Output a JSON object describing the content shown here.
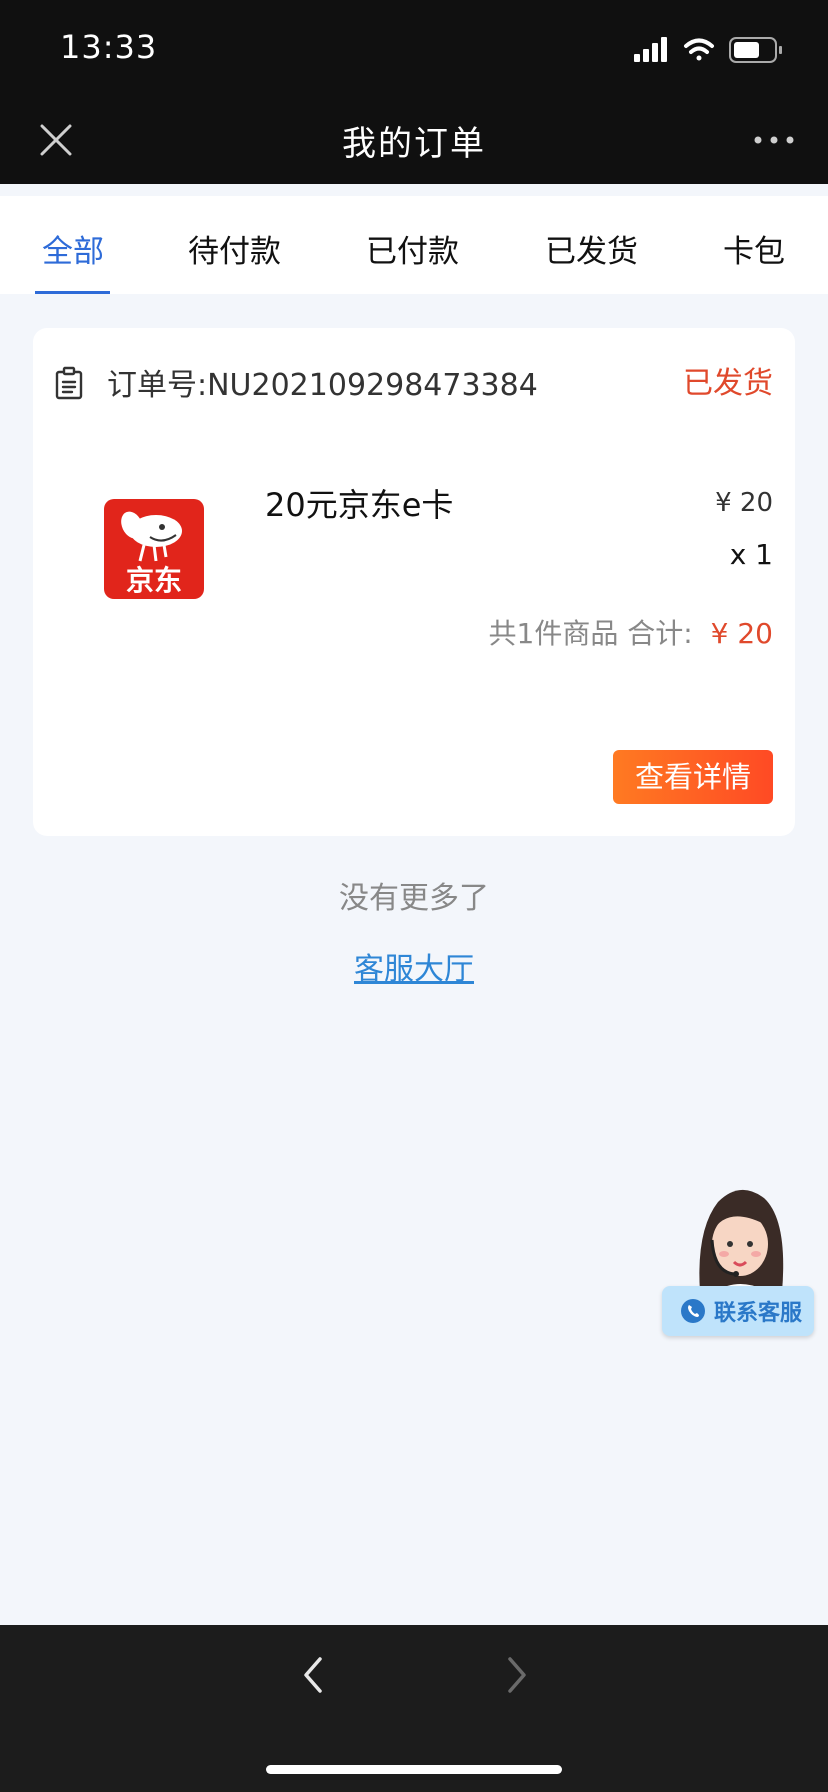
{
  "status_bar": {
    "time": "13:33"
  },
  "header": {
    "title": "我的订单"
  },
  "tabs": [
    {
      "label": "全部",
      "active": true
    },
    {
      "label": "待付款",
      "active": false
    },
    {
      "label": "已付款",
      "active": false
    },
    {
      "label": "已发货",
      "active": false
    },
    {
      "label": "卡包",
      "active": false
    }
  ],
  "order": {
    "order_number": "订单号:NU202109298473384",
    "status": "已发货",
    "product": {
      "name": "20元京东e卡",
      "logo_text": "京东",
      "price": "¥ 20",
      "quantity": "x 1"
    },
    "summary_label": "共1件商品 合计:",
    "total": "¥ 20",
    "detail_button": "查看详情"
  },
  "footer": {
    "no_more": "没有更多了",
    "service_link": "客服大厅"
  },
  "cs_widget": {
    "label": "联系客服"
  },
  "colors": {
    "accent": "#2e6bd8",
    "status_red": "#e0492c",
    "button_orange": "#ff5a24",
    "link_blue": "#2e86d6",
    "jd_red": "#e1251b"
  }
}
